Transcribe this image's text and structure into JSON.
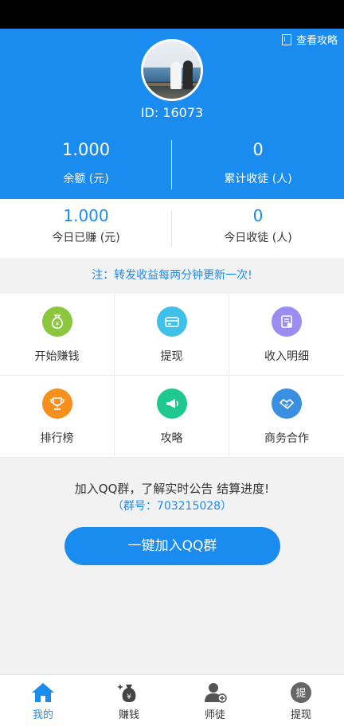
{
  "header": {
    "guide_link": "查看攻略",
    "user_id": "ID: 16073",
    "balance_value": "1.000",
    "balance_label": "余额 (元)",
    "apprentices_value": "0",
    "apprentices_label": "累计收徒 (人)"
  },
  "today": {
    "earned_value": "1.000",
    "earned_label": "今日已赚 (元)",
    "apprentices_value": "0",
    "apprentices_label": "今日收徒 (人)"
  },
  "notice": "注：转发收益每两分钟更新一次!",
  "grid": [
    {
      "label": "开始赚钱",
      "icon": "money-bag-icon",
      "color": "#8cc63f"
    },
    {
      "label": "提现",
      "icon": "card-icon",
      "color": "#3fc0e8"
    },
    {
      "label": "收入明细",
      "icon": "receipt-icon",
      "color": "#9a8cf0"
    },
    {
      "label": "排行榜",
      "icon": "trophy-icon",
      "color": "#f5901e"
    },
    {
      "label": "攻略",
      "icon": "megaphone-icon",
      "color": "#1fc88e"
    },
    {
      "label": "商务合作",
      "icon": "handshake-icon",
      "color": "#3a8fe0"
    }
  ],
  "qq": {
    "text": "加入QQ群，了解实时公告 结算进度!",
    "group_number": "（群号：703215028）",
    "button": "一键加入QQ群"
  },
  "tabs": [
    {
      "label": "我的",
      "icon": "home-icon",
      "active": true
    },
    {
      "label": "赚钱",
      "icon": "money-bag-icon",
      "active": false
    },
    {
      "label": "师徒",
      "icon": "user-add-icon",
      "active": false
    },
    {
      "label": "提现",
      "icon": "withdraw-icon",
      "active": false
    }
  ],
  "colors": {
    "primary": "#1a8cf0"
  }
}
